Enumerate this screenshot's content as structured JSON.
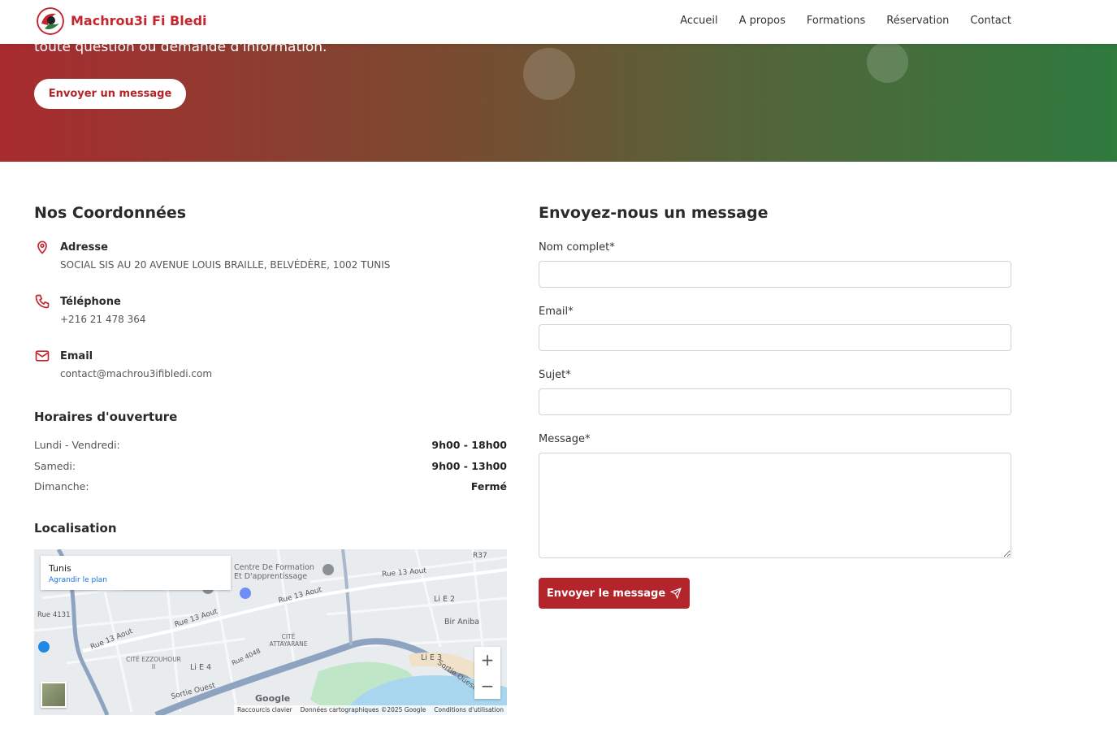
{
  "brand": {
    "name": "Machrou3i Fi Bledi"
  },
  "nav": {
    "items": [
      "Accueil",
      "A propos",
      "Formations",
      "Réservation",
      "Contact"
    ]
  },
  "hero": {
    "text": "toute question ou demande d'information.",
    "button": "Envoyer un message"
  },
  "coords": {
    "title": "Nos Coordonnées",
    "address": {
      "label": "Adresse",
      "value": "SOCIAL SIS AU 20 AVENUE LOUIS BRAILLE, BELVÉDÈRE, 1002 TUNIS",
      "icon": "map-pin-icon"
    },
    "phone": {
      "label": "Téléphone",
      "value": "+216 21 478 364",
      "icon": "phone-icon"
    },
    "email": {
      "label": "Email",
      "value": "contact@machrou3ifibledi.com",
      "icon": "mail-icon"
    }
  },
  "hours": {
    "title": "Horaires d'ouverture",
    "rows": [
      {
        "day": "Lundi - Vendredi:",
        "time": "9h00 - 18h00"
      },
      {
        "day": "Samedi:",
        "time": "9h00 - 13h00"
      },
      {
        "day": "Dimanche:",
        "time": "Fermé"
      }
    ]
  },
  "location": {
    "title": "Localisation",
    "map": {
      "city": "Tunis",
      "enlarge": "Agrandir le plan",
      "labels": [
        "Centre De Formation Et D'apprentissage",
        "Rue 13 Aout",
        "Rue 13 Aout",
        "Rue 13 Aout",
        "Rue 13 Aout",
        "Li E 2",
        "Bir Aniba",
        "Rue 4131",
        "CITÉ ATTAYARANE",
        "CITÉ EZZOUHOUR II",
        "Li E 4",
        "Li E 3",
        "Rue 4048",
        "Sortie Ouest",
        "Sortie Ouest",
        "R37"
      ],
      "google": "Google",
      "attribution": [
        "Raccourcis clavier",
        "Données cartographiques ©2025 Google",
        "Conditions d'utilisation"
      ]
    }
  },
  "form": {
    "title": "Envoyez-nous un message",
    "fields": [
      {
        "label": "Nom complet*",
        "value": ""
      },
      {
        "label": "Email*",
        "value": ""
      },
      {
        "label": "Sujet*",
        "value": ""
      },
      {
        "label": "Message*",
        "value": ""
      }
    ],
    "submit": "Envoyer le message"
  },
  "colors": {
    "brand_red": "#b3242b",
    "brand_green": "#2f7a3e"
  }
}
